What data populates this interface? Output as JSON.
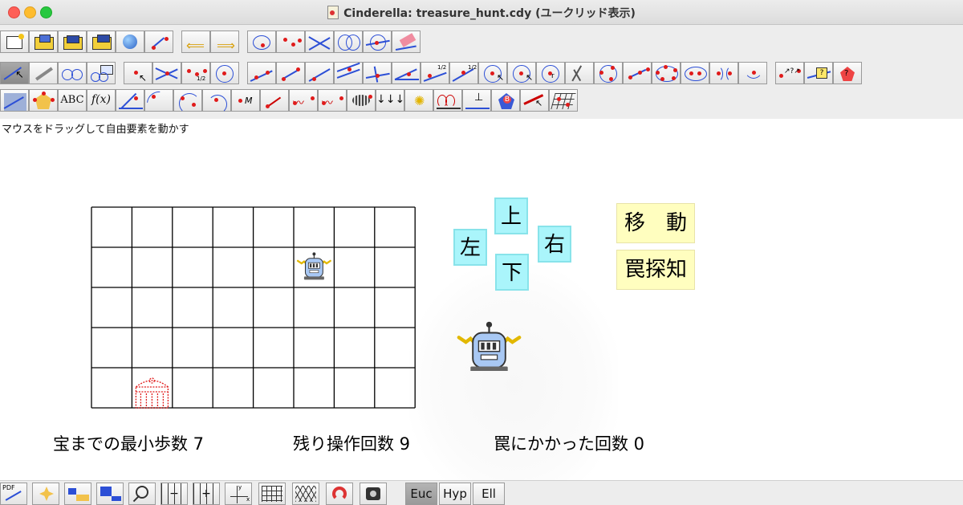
{
  "window": {
    "title": "Cinderella: treasure_hunt.cdy (ユークリッド表示)"
  },
  "status_hint": "マウスをドラッグして自由要素を動かす",
  "direction_buttons": {
    "up": "上",
    "left": "左",
    "right": "右",
    "down": "下"
  },
  "action_buttons": {
    "move": "移　動",
    "trap_detect": "罠探知"
  },
  "stats": {
    "min_steps": "宝までの最小歩数 7",
    "remaining_ops": "残り操作回数 9",
    "trap_hits": "罠にかかった回数 0"
  },
  "grid": {
    "columns": 8,
    "rows": 5,
    "robot_cell": {
      "col": 6,
      "row": 2
    },
    "treasure_cell": {
      "col": 2,
      "row": 5
    }
  },
  "geometry_modes": {
    "euclidean": "Euc",
    "hyperbolic": "Hyp",
    "elliptic": "Ell",
    "selected": "Euc"
  },
  "toolbar_icons": {
    "pdf_label": "PDF",
    "abc_label": "ABC",
    "function_label": "f(x)",
    "measure_label": "M",
    "half_label": "1/2",
    "arrows_label": "↓↓↓"
  },
  "colors": {
    "direction_button": "#aaf5fb",
    "action_button": "#fffebf",
    "point_red": "#e01b1b",
    "line_blue": "#2c4fd6"
  }
}
